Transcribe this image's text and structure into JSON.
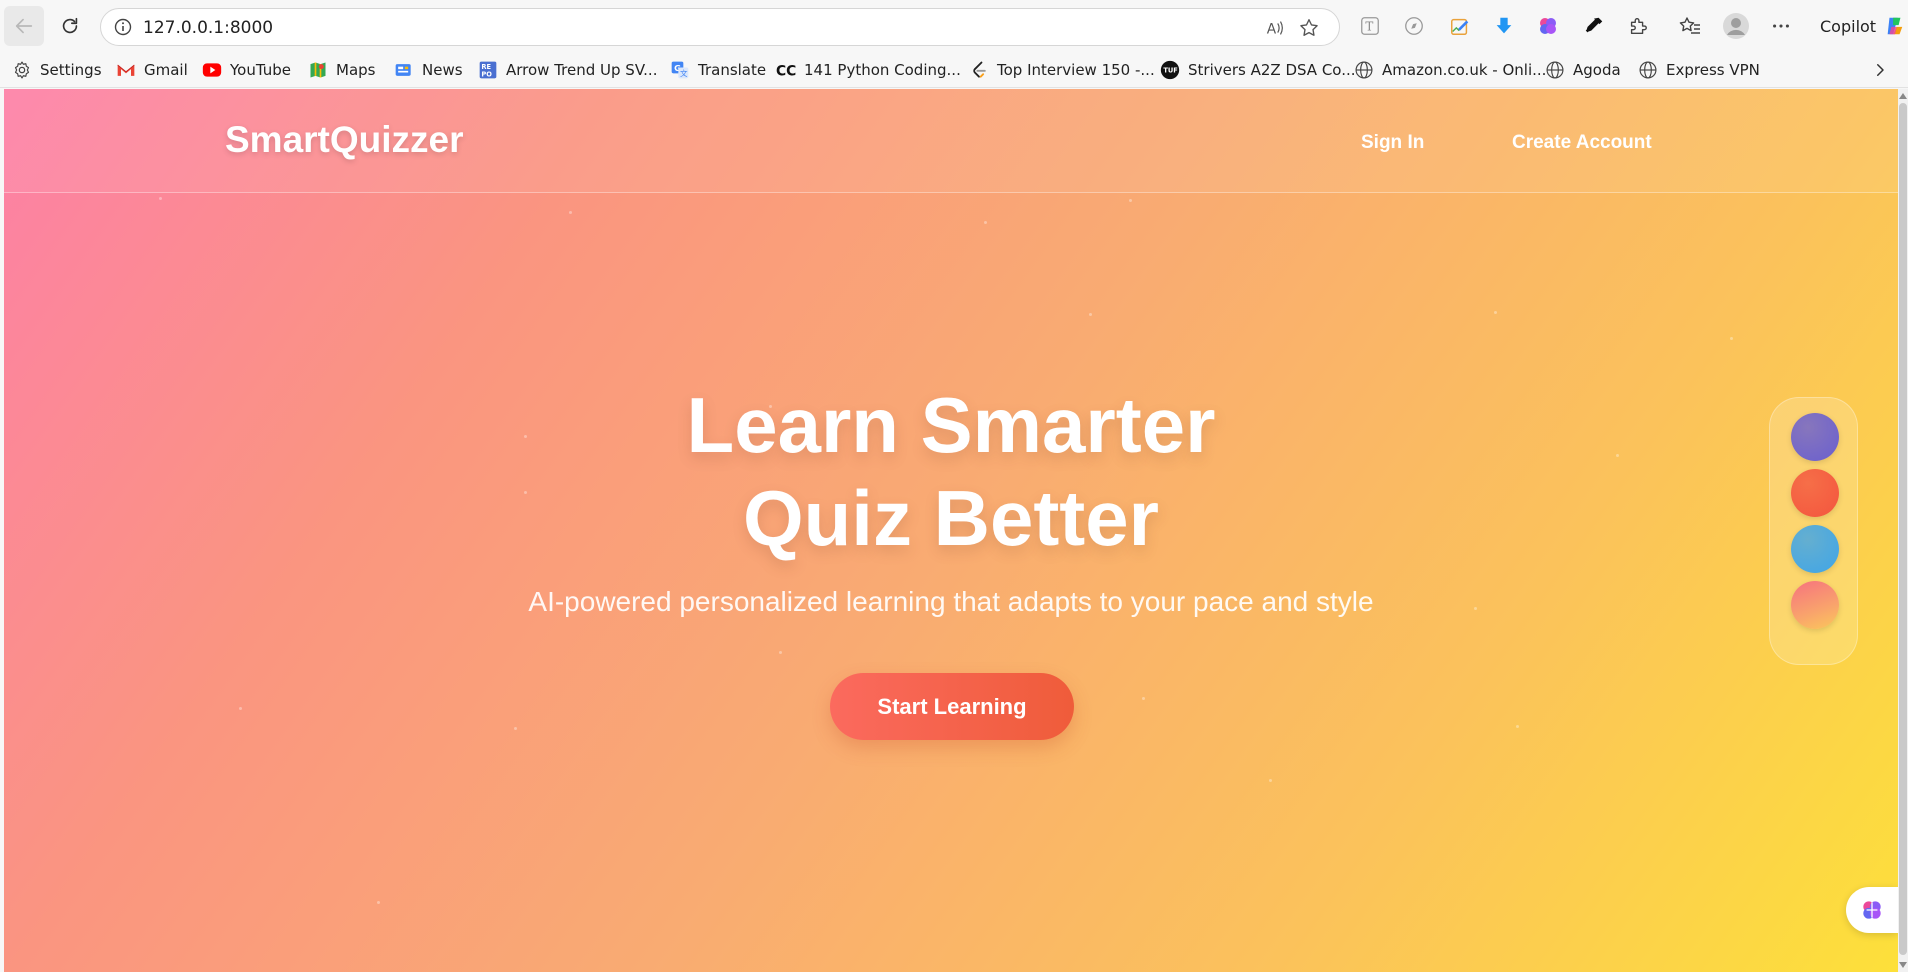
{
  "browser": {
    "url": "127.0.0.1:8000",
    "copilot_label": "Copilot"
  },
  "bookmarks": [
    {
      "label": "Settings",
      "icon": "gear-icon"
    },
    {
      "label": "Gmail",
      "icon": "gmail-icon"
    },
    {
      "label": "YouTube",
      "icon": "youtube-icon"
    },
    {
      "label": "Maps",
      "icon": "maps-icon"
    },
    {
      "label": "News",
      "icon": "news-icon"
    },
    {
      "label": "Arrow Trend Up SV...",
      "icon": "repo-icon"
    },
    {
      "label": "Translate",
      "icon": "translate-icon"
    },
    {
      "label": "141 Python Coding...",
      "icon": "cc-icon"
    },
    {
      "label": "Top Interview 150 -...",
      "icon": "leetcode-icon"
    },
    {
      "label": "Strivers A2Z DSA Co...",
      "icon": "tuf-icon"
    },
    {
      "label": "Amazon.co.uk - Onli...",
      "icon": "globe-icon"
    },
    {
      "label": "Agoda",
      "icon": "globe-icon"
    },
    {
      "label": "Express VPN",
      "icon": "globe-icon"
    }
  ],
  "site": {
    "logo": "SmartQuizzer",
    "nav": {
      "sign_in": "Sign In",
      "create_account": "Create Account"
    },
    "hero": {
      "title_line1": "Learn Smarter",
      "title_line2": "Quiz Better",
      "subtitle": "AI-powered personalized learning that adapts to your pace and style",
      "cta": "Start Learning"
    },
    "theme_swatches": [
      {
        "name": "purple",
        "color": "#6a5fcf"
      },
      {
        "name": "red",
        "color": "#f4553e"
      },
      {
        "name": "blue",
        "color": "#3fa5e8"
      },
      {
        "name": "sunset",
        "color": "#f98a7c"
      }
    ]
  },
  "colors": {
    "gradient_start": "#fd80a6",
    "gradient_end": "#fde03a",
    "cta_start": "#fb6a5e",
    "cta_end": "#ef5c3a"
  }
}
